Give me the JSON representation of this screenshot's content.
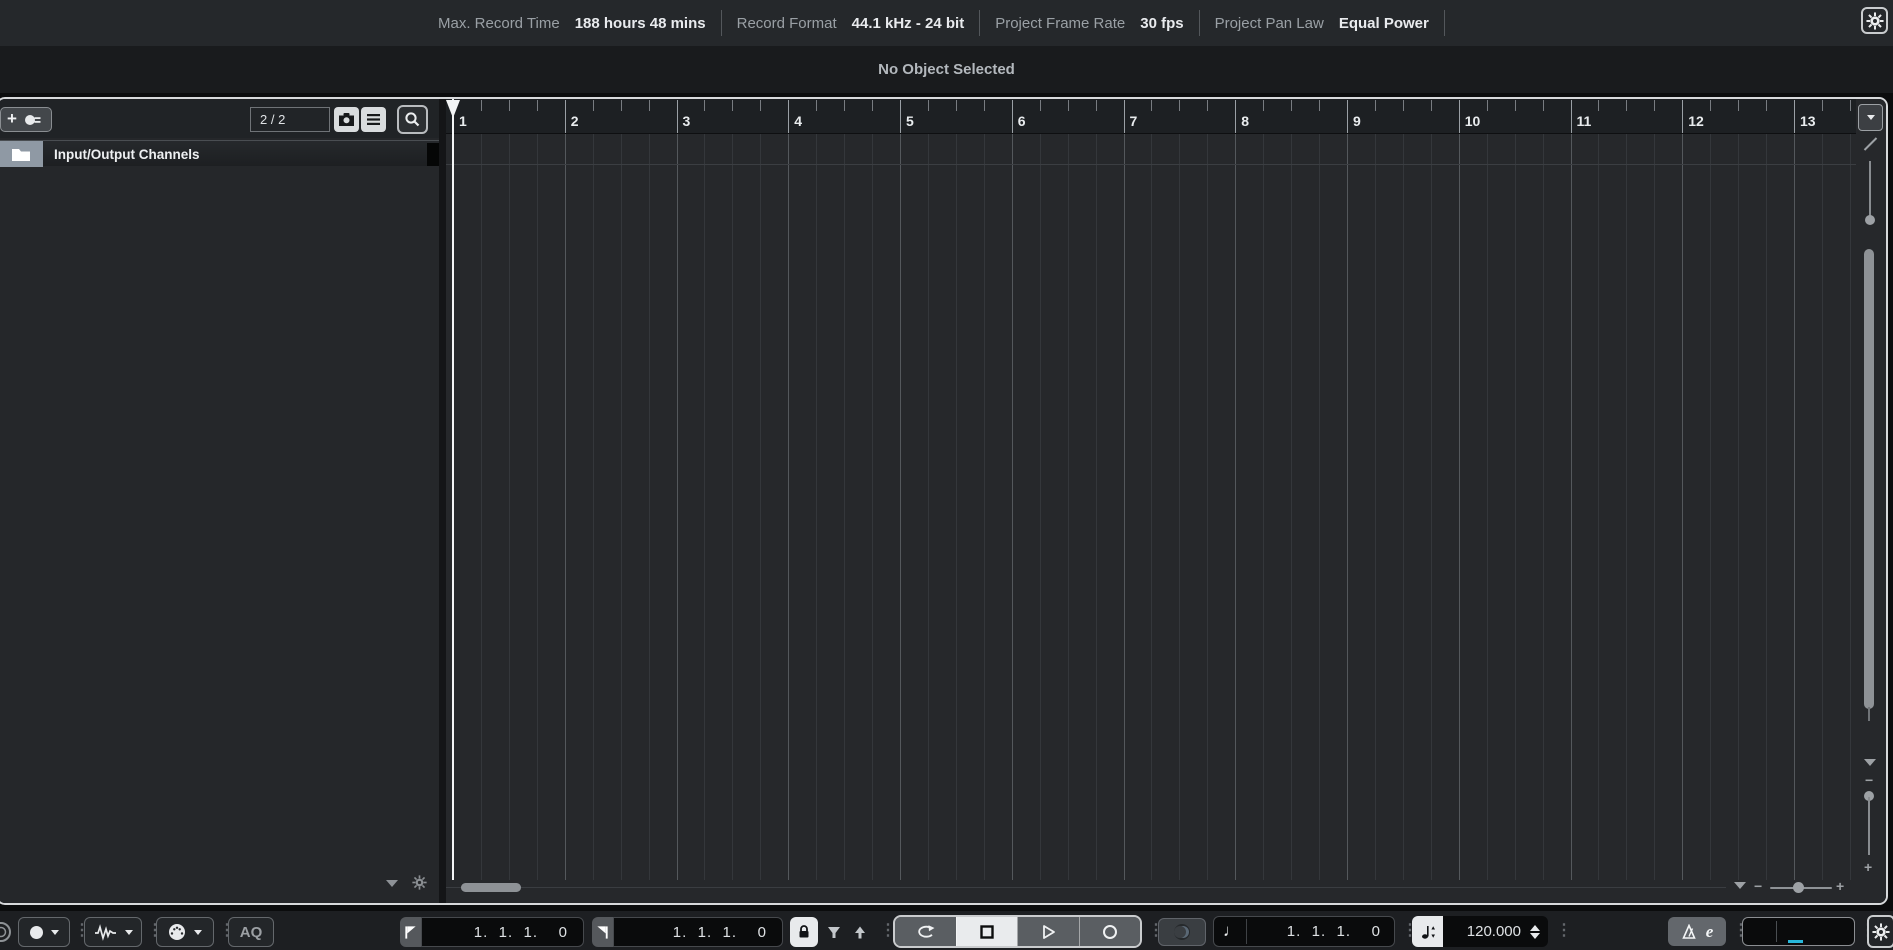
{
  "top_bar": {
    "items": [
      {
        "label": "Max. Record Time",
        "value": "188 hours 48 mins"
      },
      {
        "label": "Record Format",
        "value": "44.1 kHz - 24 bit"
      },
      {
        "label": "Project Frame Rate",
        "value": "30 fps"
      },
      {
        "label": "Project Pan Law",
        "value": "Equal Power"
      }
    ]
  },
  "info_line": {
    "status": "No Object Selected"
  },
  "track_panel": {
    "visibility_count": "2 / 2",
    "tracks": [
      {
        "name": "Input/Output Channels",
        "type": "folder"
      }
    ]
  },
  "ruler": {
    "bars": [
      "1",
      "2",
      "3",
      "4",
      "5",
      "6",
      "7",
      "8",
      "9",
      "10",
      "11",
      "12",
      "13"
    ],
    "beats_per_bar": 4
  },
  "transport": {
    "left_locator": "1.  1.  1.    0",
    "right_locator": "1.  1.  1.    0",
    "position": "1.  1.  1.    0",
    "tempo": "120.000",
    "aq_label": "AQ",
    "editor_label": "e",
    "note_glyph": "♩"
  },
  "icons": {
    "add": "+",
    "dots": "⋮",
    "minus": "−",
    "plus": "+",
    "chevron_down": "▾"
  },
  "colors": {
    "accent_meter": "#27b7da",
    "track_color": "#8f99a4"
  }
}
